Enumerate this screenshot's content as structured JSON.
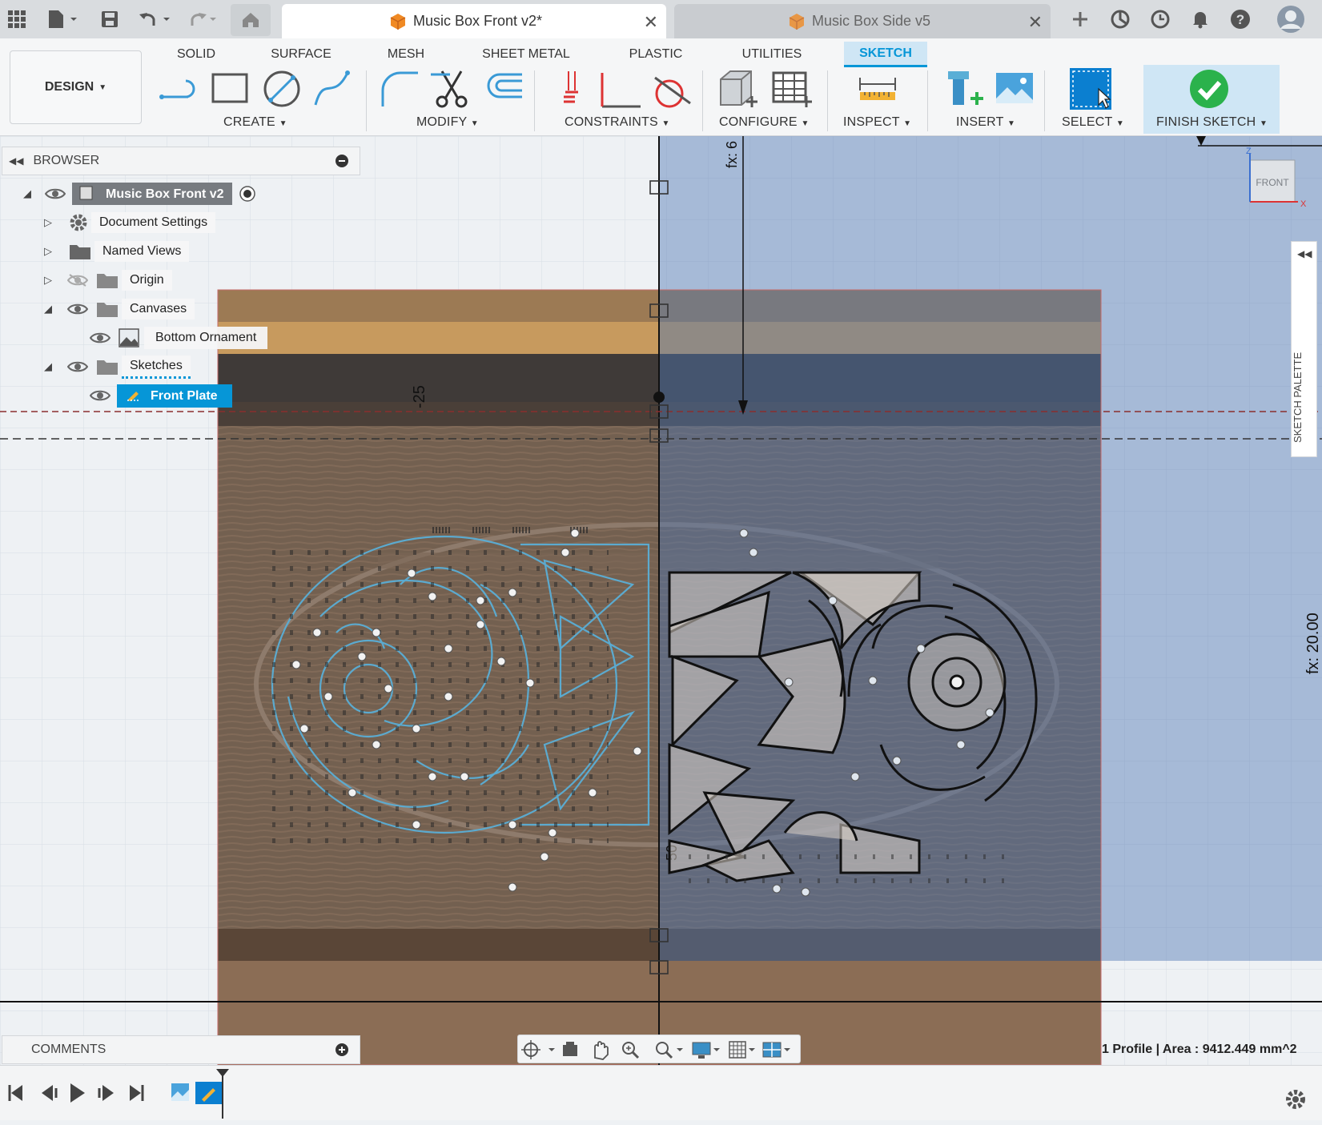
{
  "tabs": {
    "active": {
      "label": "Music Box Front v2*",
      "close": "✕"
    },
    "inactive": {
      "label": "Music Box Side v5",
      "close": "✕"
    }
  },
  "ribbon": {
    "design_label": "DESIGN",
    "workspace_tabs": [
      "SOLID",
      "SURFACE",
      "MESH",
      "SHEET METAL",
      "PLASTIC",
      "UTILITIES",
      "SKETCH"
    ],
    "active_tab": "SKETCH",
    "groups": {
      "create": "CREATE",
      "modify": "MODIFY",
      "constraints": "CONSTRAINTS",
      "configure": "CONFIGURE",
      "inspect": "INSPECT",
      "insert": "INSERT",
      "select": "SELECT",
      "finish": "FINISH SKETCH"
    }
  },
  "browser": {
    "title": "BROWSER",
    "root": "Music Box Front v2",
    "items": [
      {
        "label": "Document Settings"
      },
      {
        "label": "Named Views"
      },
      {
        "label": "Origin"
      },
      {
        "label": "Canvases"
      },
      {
        "label": "Bottom Ornament"
      },
      {
        "label": "Sketches"
      },
      {
        "label": "Front Plate"
      }
    ]
  },
  "viewport": {
    "dim_vertical_label": "-25",
    "dim_top_label": "fx: 6",
    "dim_right_label": "fx: 20.00",
    "dim_bottom_label": "50",
    "viewcube_label": "FRONT",
    "sketch_palette_label": "SKETCH PALETTE",
    "axis_z": "Z",
    "axis_x": "X"
  },
  "comments": {
    "title": "COMMENTS"
  },
  "status": {
    "text": "1 Profile | Area : 9412.449 mm^2"
  },
  "colors": {
    "accent": "#0696d7",
    "finish_green": "#2bb24c",
    "sketch_blue": "#5aaed6"
  }
}
